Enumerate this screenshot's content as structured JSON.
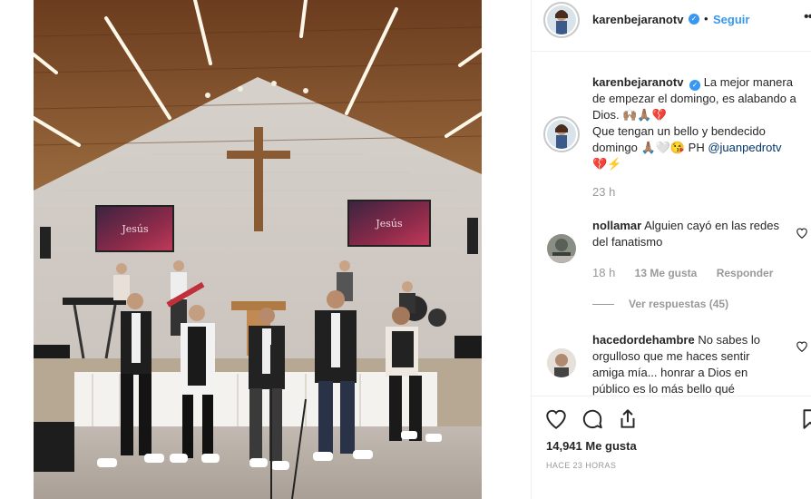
{
  "post": {
    "username": "karenbejaranotv",
    "follow_label": "Seguir",
    "separator": "•",
    "more_label": "•••",
    "verified_mark": "✓",
    "photo_sign_1": "Jesús",
    "photo_sign_2": "Jesús"
  },
  "caption": {
    "username": "karenbejaranotv",
    "text_1": "La mejor manera de empezar el domingo, es alabando a Dios. 🙌🏽🙏🏽💔",
    "text_2": "Que tengan un bello y bendecido domingo 🙏🏽🤍😘 PH ",
    "mention": "@juanpedrotv",
    "text_3": "💔⚡",
    "time": "23 h"
  },
  "comments": [
    {
      "username": "nollamar",
      "text": "Alguien cayó en las redes del fanatismo",
      "time": "18 h",
      "likes": "13 Me gusta",
      "reply_label": "Responder",
      "view_replies": "Ver respuestas (45)"
    },
    {
      "username": "hacedordehambre",
      "text": "No sabes lo orgulloso que me haces sentir amiga mía... honrar a Dios en público es lo más bello qué"
    }
  ],
  "stats": {
    "likes": "14,941 Me gusta",
    "ago": "HACE 23 HORAS"
  },
  "colors": {
    "accent": "#3897f0",
    "text": "#262626",
    "muted": "#999999",
    "border": "#efefef"
  },
  "icons": [
    "heart-icon",
    "comment-icon",
    "share-icon",
    "bookmark-icon",
    "verified-icon",
    "more-icon"
  ]
}
